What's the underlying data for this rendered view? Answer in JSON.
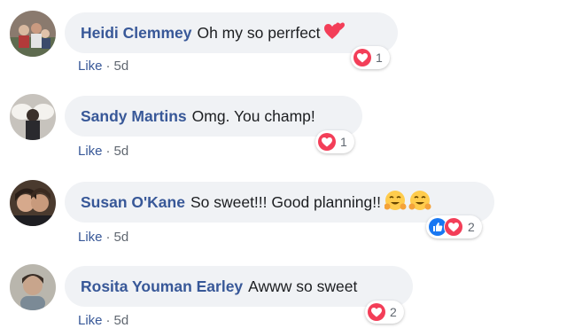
{
  "comments": [
    {
      "author": "Heidi Clemmey",
      "text": "Oh my so perrfect",
      "action": "Like",
      "time": "5d",
      "reaction_count": "1",
      "reactions": [
        "love-reaction"
      ],
      "inline_emoji": "hearts-emoji"
    },
    {
      "author": "Sandy Martins",
      "text": "Omg. You champ!",
      "action": "Like",
      "time": "5d",
      "reaction_count": "1",
      "reactions": [
        "love-reaction"
      ]
    },
    {
      "author": "Susan O'Kane",
      "text": "So sweet!!! Good planning!!",
      "action": "Like",
      "time": "5d",
      "reaction_count": "2",
      "reactions": [
        "like-reaction",
        "love-reaction"
      ],
      "inline_emoji": "hugging-face-emoji"
    },
    {
      "author": "Rosita Youman Earley",
      "text": "Awww so sweet",
      "action": "Like",
      "time": "5d",
      "reaction_count": "2",
      "reactions": [
        "love-reaction"
      ]
    }
  ],
  "colors": {
    "author": "#385898",
    "bubble": "#f0f2f5",
    "love": "#f33e58",
    "like": "#1877f2"
  },
  "separator": "·"
}
